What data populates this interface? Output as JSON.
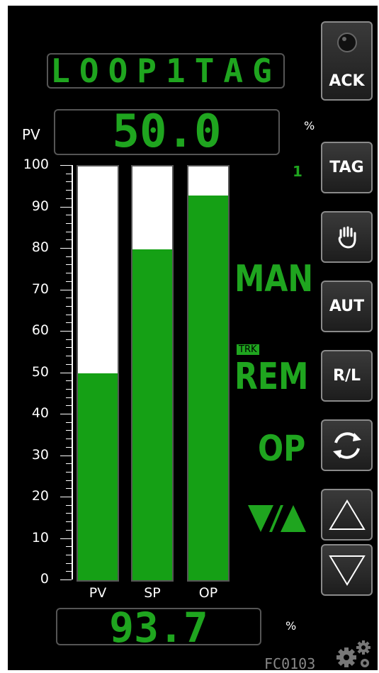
{
  "faceplate": {
    "tag": "LOOP1TAG",
    "pv_label": "PV",
    "pv_value": "50.0",
    "pv_unit": "%",
    "op_value": "93.7",
    "op_unit": "%",
    "footer_id": "FC0103",
    "tag_count": "1",
    "ylabels": [
      "100",
      "90",
      "80",
      "70",
      "60",
      "50",
      "40",
      "30",
      "20",
      "10",
      "0"
    ]
  },
  "chart_data": {
    "type": "bar",
    "categories": [
      "PV",
      "SP",
      "OP"
    ],
    "values": [
      50,
      80,
      93
    ],
    "ylim": [
      0,
      100
    ]
  },
  "buttons": {
    "ack": "ACK",
    "tag": "TAG",
    "aut": "AUT",
    "rl": "R/L"
  },
  "modes": {
    "man": "MAN",
    "rem": "REM",
    "trk": "TRK",
    "op": "OP"
  },
  "colors": {
    "green": "#15a015",
    "background": "#000000",
    "bar_empty": "#ffffff"
  }
}
